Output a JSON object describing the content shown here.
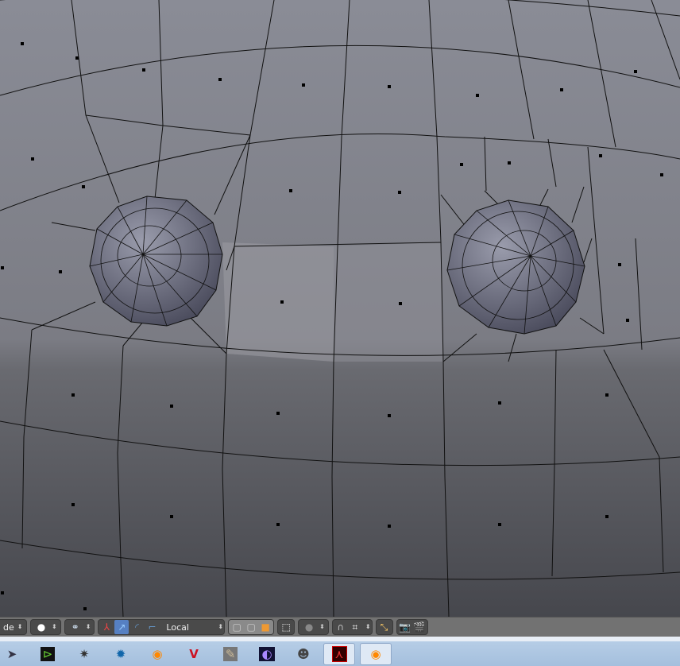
{
  "viewport": {
    "name": "3D Viewport - mesh edit mode"
  },
  "toolbar": {
    "mode_label": "de",
    "orientation_label": "Local"
  },
  "taskbar": {
    "apps": [
      "file-manager",
      "terminal",
      "settings",
      "network",
      "blender",
      "vivaldi",
      "inkscape",
      "stellarium",
      "gimp",
      "acrobat",
      "blender-active"
    ]
  }
}
